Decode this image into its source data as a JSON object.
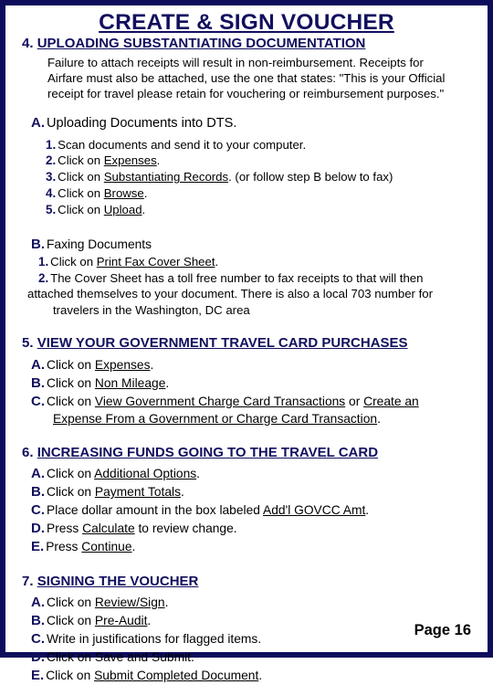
{
  "slide": {
    "title": "CREATE & SIGN VOUCHER",
    "page_label": "Page 16",
    "border_color": "#0d0d5c",
    "heading_color": "#110f5e",
    "body_color": "#000000"
  },
  "sections": [
    {
      "number": "4.",
      "title": "UPLOADING SUBSTANTIATING DOCUMENTATION",
      "paragraph": [
        "Failure to attach receipts will result in non-reimbursement. Receipts for",
        "Airfare must also be attached, use the one that states:  \"This is your Official",
        "receipt for travel please retain for vouchering or reimbursement purposes.\""
      ],
      "sub_a": {
        "marker": "A.",
        "text": "Uploading Documents into DTS.",
        "steps": [
          {
            "marker": "1.",
            "pre": "Scan documents and send it to your computer.",
            "link": "",
            "post": ""
          },
          {
            "marker": "2.",
            "pre": "Click on ",
            "link": "Expenses",
            "post": "."
          },
          {
            "marker": "3.",
            "pre": "Click on ",
            "link": "Substantiating Records",
            "post": ". (or follow step B below to fax)"
          },
          {
            "marker": "4.",
            "pre": "Click on ",
            "link": "Browse",
            "post": "."
          },
          {
            "marker": "5.",
            "pre": "Click on ",
            "link": "Upload",
            "post": "."
          }
        ]
      },
      "sub_b": {
        "marker": "B.",
        "text": "Faxing Documents",
        "step1": {
          "marker": "1.",
          "pre": "Click on ",
          "link": "Print Fax Cover Sheet",
          "post": "."
        },
        "step2": {
          "marker": "2.",
          "line1": "The Cover Sheet has a toll free number to fax receipts to that will then",
          "line2": "attached themselves to your document.   There is also a local 703 number for",
          "line3": "travelers in the Washington, DC area"
        }
      }
    },
    {
      "number": "5.",
      "title": "VIEW YOUR GOVERNMENT TRAVEL CARD PURCHASES",
      "items": [
        {
          "marker": "A.",
          "pre": "Click on ",
          "link": "Expenses",
          "post": "."
        },
        {
          "marker": "B.",
          "pre": "Click on ",
          "link": "Non Mileage",
          "post": "."
        },
        {
          "marker": "C.",
          "pre": "Click on ",
          "link": "View Government Charge Card Transactions",
          "mid": " or ",
          "link2": "Create an",
          "post": "",
          "cont_link": "Expense From a Government or Charge Card Transaction",
          "cont_post": "."
        }
      ]
    },
    {
      "number": "6.",
      "title": "INCREASING FUNDS GOING TO THE TRAVEL CARD",
      "items": [
        {
          "marker": "A.",
          "pre": "Click on ",
          "link": "Additional Options",
          "post": "."
        },
        {
          "marker": "B.",
          "pre": "Click on ",
          "link": "Payment Totals",
          "post": "."
        },
        {
          "marker": "C.",
          "pre": "Place dollar amount in the box labeled ",
          "link": "Add'l GOVCC Amt",
          "post": "."
        },
        {
          "marker": "D.",
          "pre": "Press ",
          "link": "Calculate",
          "post": " to review change."
        },
        {
          "marker": "E.",
          "pre": "Press ",
          "link": "Continue",
          "post": "."
        }
      ]
    },
    {
      "number": "7.",
      "title": "SIGNING THE VOUCHER",
      "items": [
        {
          "marker": "A.",
          "pre": "Click on ",
          "link": "Review/Sign",
          "post": "."
        },
        {
          "marker": "B.",
          "pre": "Click on ",
          "link": "Pre-Audit",
          "post": "."
        },
        {
          "marker": "C.",
          "pre": "Write in justifications for flagged items.",
          "link": "",
          "post": ""
        },
        {
          "marker": "D.",
          "pre": "Click on Save and Submit.",
          "link": "",
          "post": ""
        },
        {
          "marker": "E.",
          "pre": "Click on ",
          "link": "Submit Completed Document",
          "post": "."
        }
      ]
    }
  ]
}
